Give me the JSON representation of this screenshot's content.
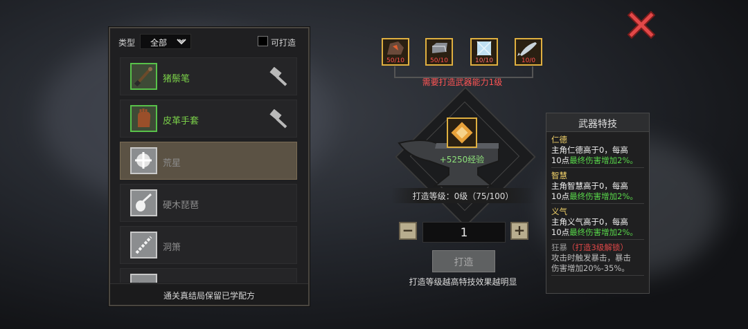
{
  "filter": {
    "type_label": "类型",
    "type_value": "全部",
    "craftable_label": "可打造",
    "craftable_checked": false
  },
  "recipes": [
    {
      "name": "猪鬃笔",
      "icon": "brush-icon",
      "unlocked": true,
      "hammer": "hammer-icon"
    },
    {
      "name": "皮革手套",
      "icon": "leather-glove-icon",
      "unlocked": true,
      "hammer": "hammer-icon"
    },
    {
      "name": "荒星",
      "icon": "star-weapon-icon",
      "unlocked": false,
      "selected": true
    },
    {
      "name": "硬木琵琶",
      "icon": "pipa-icon",
      "unlocked": false
    },
    {
      "name": "洞箫",
      "icon": "flute-icon",
      "unlocked": false
    },
    {
      "name": "",
      "icon": "axe-icon",
      "unlocked": false
    }
  ],
  "footer_note": "通关真结局保留已学配方",
  "materials": [
    {
      "icon": "ore-icon",
      "count": "50/10"
    },
    {
      "icon": "iron-ingot-icon",
      "count": "50/10"
    },
    {
      "icon": "ice-crystal-icon",
      "count": "10/10"
    },
    {
      "icon": "fish-icon",
      "count": "10/0"
    }
  ],
  "requirement": "需要打造武器能力1级",
  "reward_exp": "+5250经验",
  "forge_level": "打造等级：0级（75/100）",
  "quantity": "1",
  "forge_button": "打造",
  "forge_tip": "打造等级越高特技效果越明显",
  "skills": {
    "title": "武器特技",
    "entries": [
      {
        "name": "仁德",
        "line1": "主角仁德高于0，每高",
        "line2a": "10点",
        "line2b": "最终伤害增加2%。"
      },
      {
        "name": "智慧",
        "line1": "主角智慧高于0，每高",
        "line2a": "10点",
        "line2b": "最终伤害增加2%。"
      },
      {
        "name": "义气",
        "line1": "主角义气高于0，每高",
        "line2a": "10点",
        "line2b": "最终伤害增加2%。"
      }
    ],
    "locked": {
      "name": "狂暴",
      "note": "（打造3级解锁）",
      "line1": "攻击时触发暴击，暴击",
      "line2": "伤害增加20%-35%。"
    }
  }
}
